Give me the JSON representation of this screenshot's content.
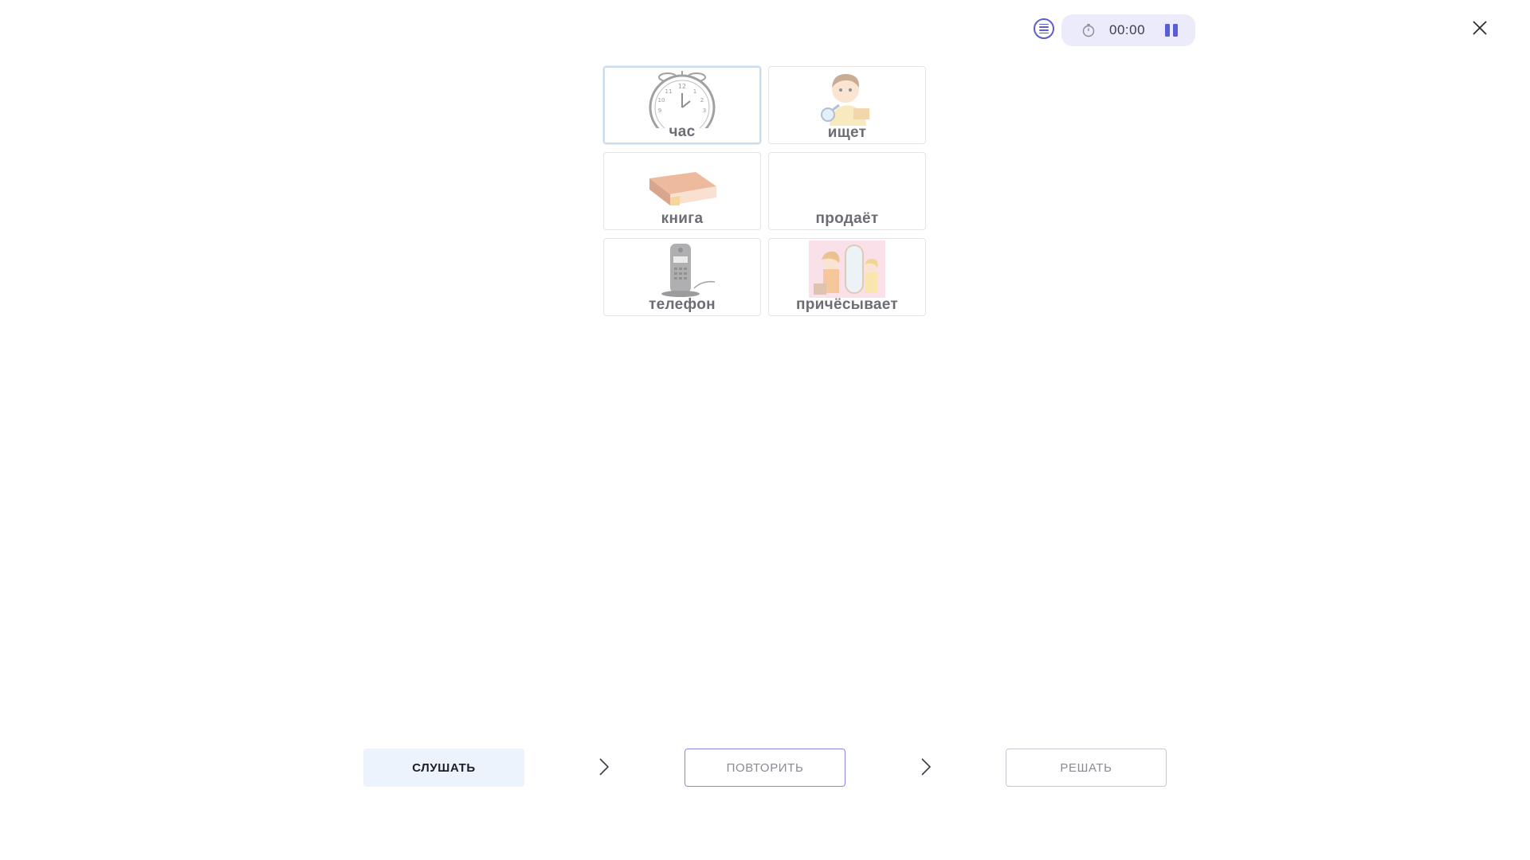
{
  "timer": {
    "time": "00:00"
  },
  "cards": [
    {
      "label": "час"
    },
    {
      "label": "ищет"
    },
    {
      "label": "книга"
    },
    {
      "label": "продаёт"
    },
    {
      "label": "телефон"
    },
    {
      "label": "причёсывает"
    }
  ],
  "buttons": {
    "listen": "СЛУШАТЬ",
    "repeat": "ПОВТОРИТЬ",
    "solve": "РЕШАТЬ"
  },
  "icons": {
    "menu": "menu-list-icon",
    "stopwatch": "stopwatch-icon",
    "pause": "pause-icon",
    "close": "close-icon",
    "step_arrow": "chevron-right-icon"
  },
  "colors": {
    "accent": "#5a5ed6",
    "timer_bg": "#ebebfb",
    "listen_bg": "#edf3fc",
    "repeat_border": "#8b84e8",
    "selected_border": "#c9dcf0",
    "label_text": "#6c6c74"
  }
}
